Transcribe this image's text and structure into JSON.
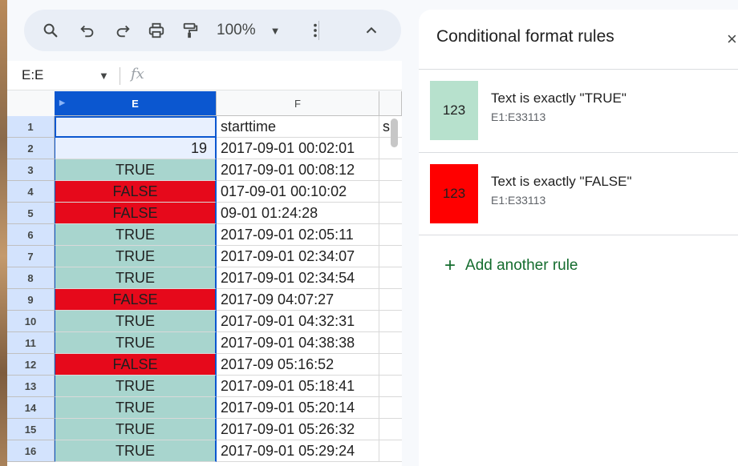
{
  "toolbar": {
    "zoom": "100%",
    "icons": [
      "search-icon",
      "undo-icon",
      "redo-icon",
      "print-icon",
      "paint-format-icon",
      "more-vert-icon",
      "chevron-up-icon"
    ]
  },
  "formula_bar": {
    "name_box": "E:E",
    "fx": "fx"
  },
  "grid": {
    "columns": [
      "E",
      "F"
    ],
    "rows": [
      {
        "n": "1",
        "e": "",
        "f": "starttime",
        "g": "s"
      },
      {
        "n": "2",
        "e": "19",
        "f": "2017-09-01 00:02:01",
        "g": ""
      },
      {
        "n": "3",
        "e": "TRUE",
        "f": "2017-09-01 00:08:12",
        "g": ""
      },
      {
        "n": "4",
        "e": "FALSE",
        "f": "017-09-01 00:10:02",
        "g": ""
      },
      {
        "n": "5",
        "e": "FALSE",
        "f": "09-01 01:24:28",
        "g": ""
      },
      {
        "n": "6",
        "e": "TRUE",
        "f": "2017-09-01 02:05:11",
        "g": ""
      },
      {
        "n": "7",
        "e": "TRUE",
        "f": "2017-09-01 02:34:07",
        "g": ""
      },
      {
        "n": "8",
        "e": "TRUE",
        "f": "2017-09-01 02:34:54",
        "g": ""
      },
      {
        "n": "9",
        "e": "FALSE",
        "f": "2017-09 04:07:27",
        "g": ""
      },
      {
        "n": "10",
        "e": "TRUE",
        "f": "2017-09-01 04:32:31",
        "g": ""
      },
      {
        "n": "11",
        "e": "TRUE",
        "f": "2017-09-01 04:38:38",
        "g": ""
      },
      {
        "n": "12",
        "e": "FALSE",
        "f": "2017-09 05:16:52",
        "g": ""
      },
      {
        "n": "13",
        "e": "TRUE",
        "f": "2017-09-01 05:18:41",
        "g": ""
      },
      {
        "n": "14",
        "e": "TRUE",
        "f": "2017-09-01 05:20:14",
        "g": ""
      },
      {
        "n": "15",
        "e": "TRUE",
        "f": "2017-09-01 05:26:32",
        "g": ""
      },
      {
        "n": "16",
        "e": "TRUE",
        "f": "2017-09-01 05:29:24",
        "g": ""
      }
    ]
  },
  "panel": {
    "title": "Conditional format rules",
    "close": "×",
    "rules": [
      {
        "swatch_label": "123",
        "swatch_color": "#b7e1cd",
        "text": "Text is exactly \"TRUE\"",
        "range": "E1:E33113"
      },
      {
        "swatch_label": "123",
        "swatch_color": "#ff0000",
        "text": "Text is exactly \"FALSE\"",
        "range": "E1:E33113"
      }
    ],
    "add_rule": "Add another rule",
    "accent": "#146c2e"
  },
  "colors": {
    "true_fill": "#a8d5ce",
    "false_fill": "#e6091b",
    "selection": "#0b57d0"
  }
}
